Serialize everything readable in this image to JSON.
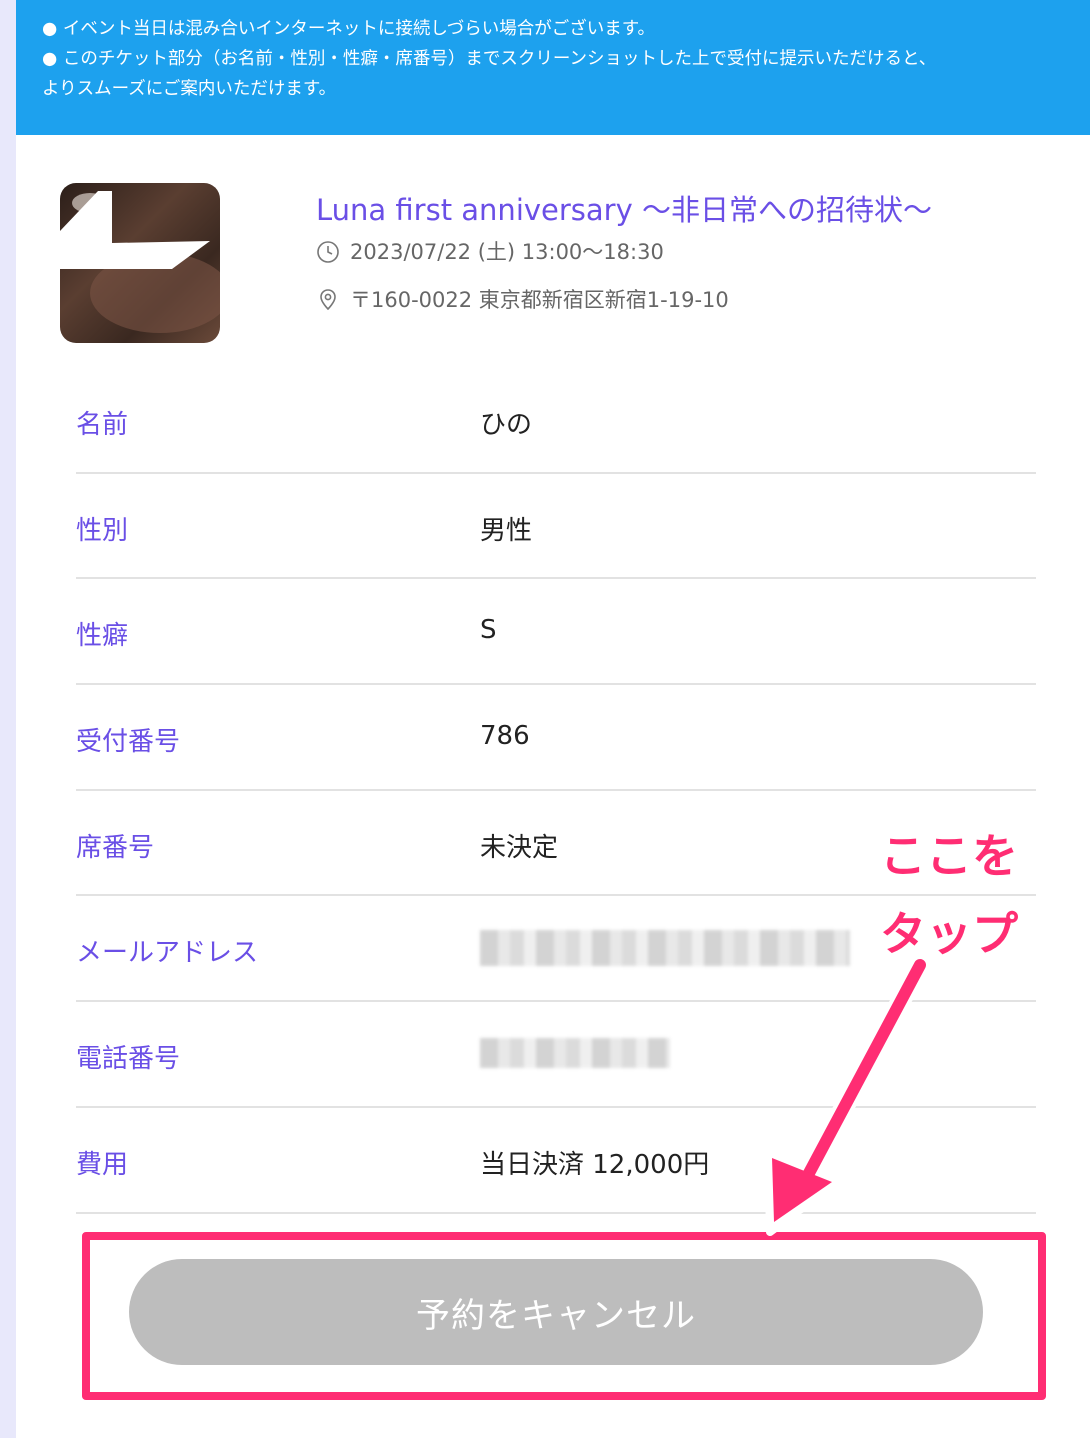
{
  "notice": {
    "line1": "● イベント当日は混み合いインターネットに接続しづらい場合がございます。",
    "line2": "● このチケット部分（お名前・性別・性癖・席番号）までスクリーンショットした上で受付に提示いただけると、",
    "line3": "よりスムーズにご案内いただけます。"
  },
  "event": {
    "title": "Luna first anniversary 〜非日常への招待状〜",
    "datetime": "2023/07/22 (土) 13:00〜18:30",
    "address": "〒160-0022 東京都新宿区新宿1-19-10"
  },
  "ticket": {
    "name_label": "名前",
    "name_value": "ひの",
    "gender_label": "性別",
    "gender_value": "男性",
    "preference_label": "性癖",
    "preference_value": "S",
    "reception_label": "受付番号",
    "reception_value": "786",
    "seat_label": "席番号",
    "seat_value": "未決定",
    "email_label": "メールアドレス",
    "phone_label": "電話番号",
    "fee_label": "費用",
    "fee_value": "当日決済 12,000円"
  },
  "actions": {
    "cancel_label": "予約をキャンセル"
  },
  "annotation": {
    "line1": "ここを",
    "line2": "タップ"
  },
  "colors": {
    "notice_bg": "#1da1ee",
    "accent": "#6a4fe6",
    "highlight": "#ff2d73",
    "button_disabled": "#bdbdbd"
  },
  "icons": [
    "clock-icon",
    "location-pin-icon"
  ]
}
